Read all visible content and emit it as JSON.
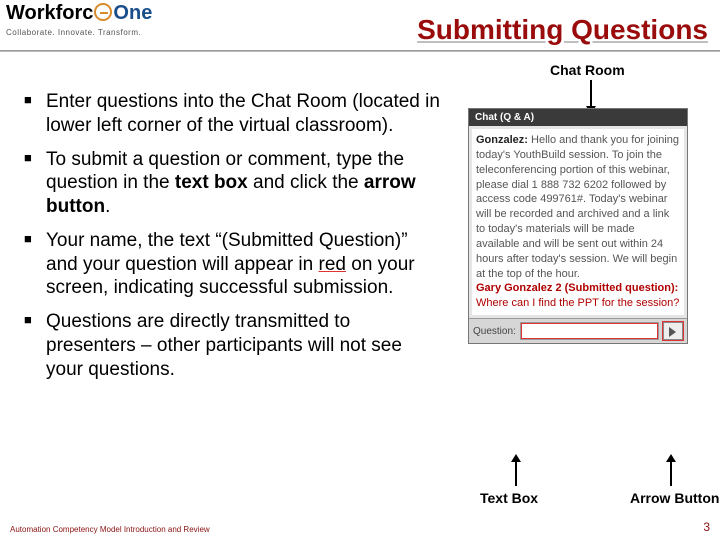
{
  "header": {
    "logo_main": "Workforc",
    "logo_suffix": "One",
    "tagline": "Collaborate.  Innovate.  Transform.",
    "title": "Submitting Questions"
  },
  "labels": {
    "chat_room": "Chat Room",
    "text_box": "Text Box",
    "arrow_button": "Arrow Button"
  },
  "bullets": [
    {
      "html": "Enter questions into the Chat Room (located in lower left corner of the virtual classroom)."
    },
    {
      "html": "To submit a question or comment, type the question in the <b>text box</b> and click the <b>arrow button</b>."
    },
    {
      "html": "Your name, the text “(Submitted Question)” and your question will appear in <u>red</u> on your screen, indicating successful submission."
    },
    {
      "html": "Questions are directly transmitted to presenters – other participants will not see your questions."
    }
  ],
  "chat": {
    "title": "Chat (Q & A)",
    "speaker": "Gonzalez:",
    "message": " Hello and thank you for joining today's YouthBuild session. To join the teleconferencing portion of this webinar, please dial 1 888 732 6202 followed by access code 499761#. Today's webinar will be recorded and archived and a link to today's materials will be made available and will be sent out within 24 hours after today's session. We will begin at the top of the hour.",
    "submitted_name": "Gary Gonzalez 2 (Submitted question):",
    "submitted_text": " Where can I find the PPT for the session?",
    "input_label": "Question:"
  },
  "footer": {
    "left": "Automation Competency Model Introduction and Review",
    "page": "3"
  }
}
